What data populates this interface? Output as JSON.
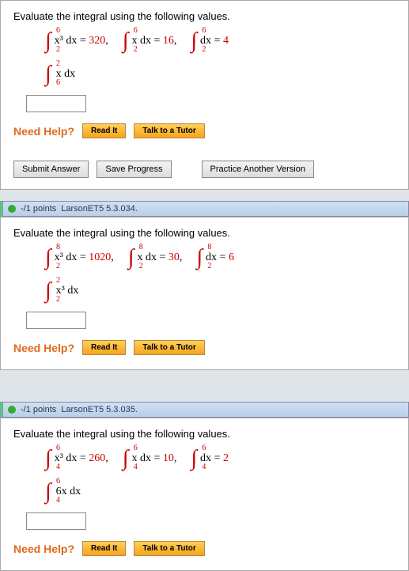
{
  "common": {
    "prompt": "Evaluate the integral using the following values.",
    "need_help": "Need Help?",
    "read_it": "Read It",
    "tutor": "Talk to a Tutor",
    "submit": "Submit Answer",
    "save": "Save Progress",
    "practice": "Practice Another Version",
    "points_label": "-/1 points"
  },
  "q1": {
    "givens": [
      {
        "lo": "2",
        "up": "6",
        "body": "x³ dx",
        "value": "320"
      },
      {
        "lo": "2",
        "up": "6",
        "body": "x dx",
        "value": "16"
      },
      {
        "lo": "2",
        "up": "6",
        "body": "dx",
        "value": "4"
      }
    ],
    "ask": {
      "lo": "6",
      "up": "2",
      "body": "x dx"
    }
  },
  "q2": {
    "ref": "LarsonET5 5.3.034.",
    "givens": [
      {
        "lo": "2",
        "up": "8",
        "body": "x³ dx",
        "value": "1020"
      },
      {
        "lo": "2",
        "up": "8",
        "body": "x dx",
        "value": "30"
      },
      {
        "lo": "2",
        "up": "8",
        "body": "dx",
        "value": "6"
      }
    ],
    "ask": {
      "lo": "2",
      "up": "2",
      "body": "x³ dx"
    }
  },
  "q3": {
    "ref": "LarsonET5 5.3.035.",
    "givens": [
      {
        "lo": "4",
        "up": "6",
        "body": "x³ dx",
        "value": "260"
      },
      {
        "lo": "4",
        "up": "6",
        "body": "x dx",
        "value": "10"
      },
      {
        "lo": "4",
        "up": "6",
        "body": "dx",
        "value": "2"
      }
    ],
    "ask": {
      "lo": "4",
      "up": "6",
      "body": "6x dx"
    }
  }
}
